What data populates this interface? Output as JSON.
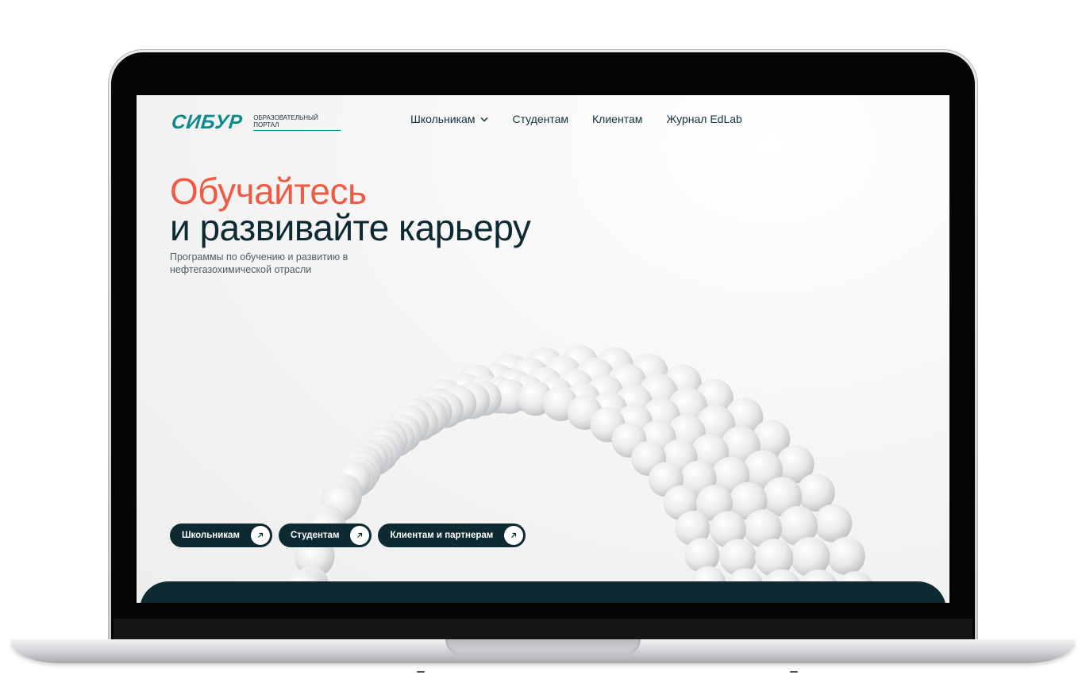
{
  "logo": {
    "mark": "СИБУР",
    "subtitle": "ОБРАЗОВАТЕЛЬНЫЙ ПОРТАЛ"
  },
  "nav": {
    "items": [
      {
        "label": "Школьникам",
        "has_dropdown": true
      },
      {
        "label": "Студентам",
        "has_dropdown": false
      },
      {
        "label": "Клиентам",
        "has_dropdown": false
      },
      {
        "label": "Журнал EdLab",
        "has_dropdown": false
      }
    ]
  },
  "hero": {
    "title_accent": "Обучайтесь",
    "title_main": "и развивайте карьеру",
    "subtitle": "Программы по обучению и развитию в нефтегазохимической отрасли"
  },
  "cta": [
    {
      "label": "Школьникам",
      "icon": "arrow-up-right-icon"
    },
    {
      "label": "Студентам",
      "icon": "arrow-up-right-icon"
    },
    {
      "label": "Клиентам и партнерам",
      "icon": "arrow-up-right-icon"
    }
  ],
  "colors": {
    "brand": "#0d8a8c",
    "accent": "#ef5b42",
    "dark": "#0d2a33"
  }
}
